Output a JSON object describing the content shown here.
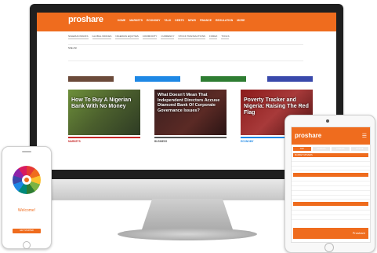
{
  "colors": {
    "brand_orange": "#ef6c1e",
    "negative": "#c62828",
    "positive": "#2e7d32",
    "monitor_frame": "#1f1f1f"
  },
  "site": {
    "logo_text": "proshare",
    "logo_tagline": "",
    "nav": [
      "HOME",
      "MARKETS",
      "ECONOMY",
      "TALK",
      "DEBTS",
      "NEWS",
      "FINANCE",
      "REGULATION",
      "MORE"
    ],
    "subnav": [
      "NIGERIAN BANKS",
      "GLOBAL INDICES",
      "NIGERIAN EQUITIES",
      "COMMODITY",
      "CURRENCY",
      "STOCK TRANSACTIONS",
      "FOREX",
      "TOOLS"
    ],
    "tickers": [
      {
        "name": "NSE ASI",
        "price": "",
        "change": "",
        "neg": false
      },
      {
        "name": "",
        "price": "",
        "change": "",
        "neg": true
      },
      {
        "name": "",
        "price": "",
        "change": "",
        "neg": false
      },
      {
        "name": "",
        "price": "",
        "change": "",
        "neg": true
      },
      {
        "name": "",
        "price": "",
        "change": "",
        "neg": false
      },
      {
        "name": "",
        "price": "",
        "change": "",
        "neg": false
      }
    ],
    "price_list_title": "",
    "marquee_text": "",
    "sheet_buttons": [
      {
        "label": "",
        "color": "#6b4a3a"
      },
      {
        "label": "",
        "color": "#1e88e5"
      },
      {
        "label": "",
        "color": "#2e7d32"
      },
      {
        "label": "",
        "color": "#3949ab"
      }
    ],
    "articles": [
      {
        "title": "How To Buy A Nigerian Bank With No Money",
        "category": "MARKETS",
        "cat_color": "#c62828"
      },
      {
        "title": "What Doesn't Mean That Independent Directors Accuse Diamond Bank Of Corporate Governance Issues?",
        "category": "BUSINESS",
        "cat_color": "#555555"
      },
      {
        "title": "Poverty Tracker and Nigeria: Raising The Red Flag",
        "category": "ECONOMY",
        "cat_color": "#1e88e5"
      }
    ]
  },
  "tablet": {
    "logo": "proshare",
    "menu_icon": "menu-icon",
    "tabs": [
      "TOP",
      "GAINERS",
      "LOSERS",
      "ACTIVE"
    ],
    "section1": "MARKET MOVERS",
    "rows1": [
      {
        "a": "",
        "b": "",
        "c": "",
        "neg": false
      },
      {
        "a": "",
        "b": "",
        "c": "",
        "neg": false
      },
      {
        "a": "",
        "b": "",
        "c": "",
        "neg": true
      }
    ],
    "section2": "",
    "rows2": [
      {
        "a": "",
        "b": "",
        "c": "",
        "neg": false
      },
      {
        "a": "",
        "b": "",
        "c": "",
        "neg": false
      },
      {
        "a": "",
        "b": "",
        "c": "",
        "neg": true
      },
      {
        "a": "",
        "b": "",
        "c": "",
        "neg": false
      },
      {
        "a": "",
        "b": "",
        "c": "",
        "neg": false
      }
    ],
    "section3": "",
    "rows3": [
      {
        "a": "",
        "b": "",
        "c": "",
        "neg": false
      },
      {
        "a": "",
        "b": "",
        "c": "",
        "neg": false
      },
      {
        "a": "",
        "b": "",
        "c": "",
        "neg": false
      }
    ],
    "ad_text": "Proshare"
  },
  "phone": {
    "welcome": "Welcome!",
    "subtext": "",
    "button": "GET STARTED"
  }
}
